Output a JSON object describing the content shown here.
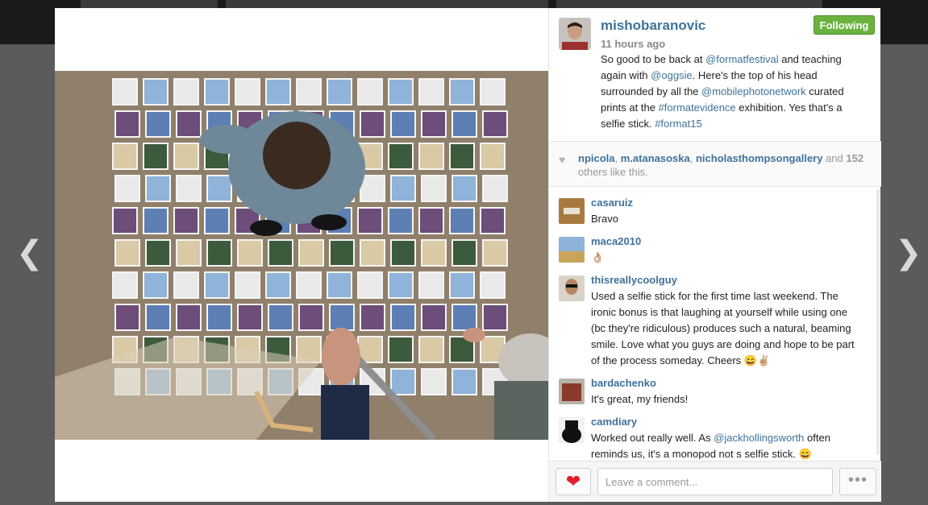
{
  "nav": {
    "prev_glyph": "❮",
    "next_glyph": "❯"
  },
  "post": {
    "username": "mishobaranovic",
    "time": "11 hours ago",
    "follow_label": "Following",
    "caption": {
      "t1": "So good to be back at ",
      "m1": "@formatfestival",
      "t2": " and teaching again with ",
      "m2": "@oggsie",
      "t3": ". Here's the top of his head surrounded by all the ",
      "m3": "@mobilephotonetwork",
      "t4": " curated prints at the ",
      "h1": "#formatevidence",
      "t5": " exhibition. Yes that's a selfie stick. ",
      "h2": "#format15"
    }
  },
  "likes": {
    "heart_icon": "heart-icon",
    "user1": "npicola",
    "sep1": ", ",
    "user2": "m.atanasoska",
    "sep2": ", ",
    "user3": "nicholasthompsongallery",
    "and": " and ",
    "count": "152",
    "suffix": " others like this."
  },
  "comments": [
    {
      "user": "casaruiz",
      "text": "Bravo"
    },
    {
      "user": "maca2010",
      "text": "👌🏼"
    },
    {
      "user": "thisreallycoolguy",
      "text": "Used a selfie stick for the first time last weekend. The ironic bonus is that laughing at yourself while using one (bc they're ridiculous) produces such a natural, beaming smile. Love what you guys are doing and hope to be part of the process someday. Cheers 😄✌🏼"
    },
    {
      "user": "bardachenko",
      "text": "It's great, my friends!"
    },
    {
      "user": "camdiary",
      "text_a": "Worked out really well. As ",
      "mention": "@jackhollingsworth",
      "text_b": " often reminds us, it's a monopod not s selfie stick. 😄"
    }
  ],
  "footer": {
    "like_glyph": "❤",
    "comment_placeholder": "Leave a comment...",
    "more_glyph": "•••"
  },
  "colors": {
    "link": "#3f729b",
    "follow": "#6bb23f",
    "like": "#e21f2f"
  }
}
